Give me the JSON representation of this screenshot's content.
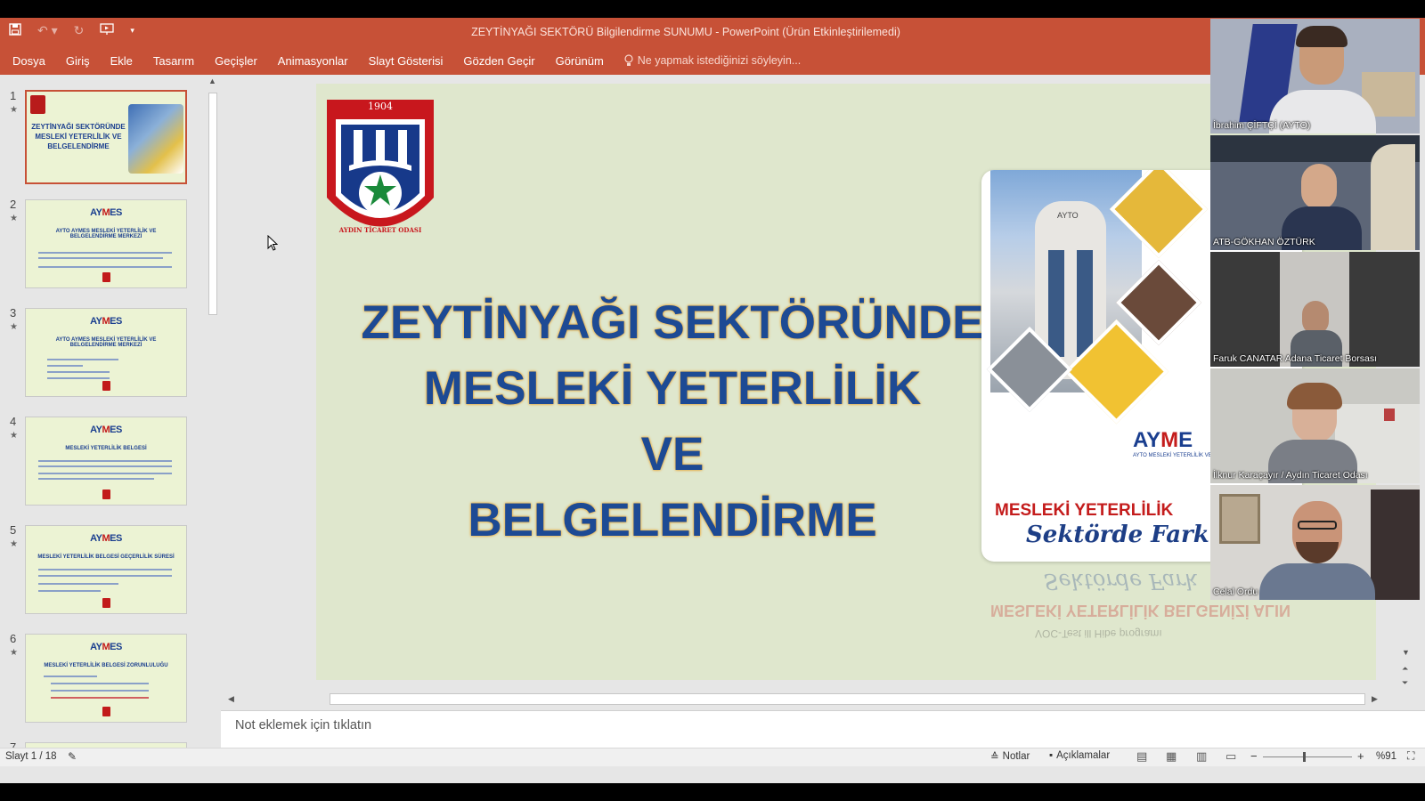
{
  "window": {
    "title": "ZEYTİNYAĞI SEKTÖRÜ Bilgilendirme SUNUMU - PowerPoint (Ürün Etkinleştirilemedi)"
  },
  "ribbon": {
    "tabs": [
      "Dosya",
      "Giriş",
      "Ekle",
      "Tasarım",
      "Geçişler",
      "Animasyonlar",
      "Slayt Gösterisi",
      "Gözden Geçir",
      "Görünüm"
    ],
    "tell_me": "Ne yapmak istediğinizi söyleyin..."
  },
  "thumbnails": [
    {
      "num": "1",
      "title": "ZEYTİNYAĞI SEKTÖRÜNDE MESLEKİ YETERLİLİK VE BELGELENDİRME"
    },
    {
      "num": "2",
      "title": "AYTO AYMES MESLEKİ YETERLİLİK VE BELGELENDİRME MERKEZİ"
    },
    {
      "num": "3",
      "title": "AYTO AYMES MESLEKİ YETERLİLİK VE BELGELENDİRME MERKEZİ"
    },
    {
      "num": "4",
      "title": "MESLEKİ YETERLİLİK BELGESİ"
    },
    {
      "num": "5",
      "title": "MESLEKİ YETERLİLİK BELGESİ GEÇERLİLİK SÜRESİ"
    },
    {
      "num": "6",
      "title": "MESLEKİ YETERLİLİK BELGESİ ZORUNLULUĞU"
    },
    {
      "num": "7",
      "title": ""
    }
  ],
  "thumb_logo": {
    "a": "AY",
    "b": "M",
    "c": "ES"
  },
  "slide": {
    "logo_year": "1904",
    "logo_text": "AYDIN TİCARET ODASI",
    "title_lines": [
      "ZEYTİNYAĞI SEKTÖRÜNDE",
      "MESLEKİ YETERLİLİK",
      "VE",
      "BELGELENDİRME"
    ],
    "brochure": {
      "building_sign": "AYTO",
      "brand_a": "AY",
      "brand_b": "M",
      "brand_c": "E",
      "brand_sub": "AYTO MESLEKİ YETERLİLİK VE BELGELENDİRME MERKEZİ",
      "headline": "MESLEKİ YETERLİLİK",
      "subline": "Sektörde Fark",
      "reflect_1": "MESLEKİ YETERLİLİK BELGENİZİ ALIN",
      "reflect_2": "VOC-Test ill Hibe programı"
    }
  },
  "notes": {
    "placeholder": "Not eklemek için tıklatın"
  },
  "status": {
    "slide_counter": "Slayt 1 / 18",
    "notes_label": "Notlar",
    "comments_label": "Açıklamalar",
    "zoom": "%91"
  },
  "participants": [
    {
      "name": "İbrahim ÇİFTÇİ (AYTO)",
      "bg": "#a9b0bf"
    },
    {
      "name": "ATB-GÖKHAN ÖZTÜRK",
      "bg": "#5d6677"
    },
    {
      "name": "Faruk CANATAR Adana Ticaret Borsası",
      "bg": "#3a3a3a"
    },
    {
      "name": "İlknur Karaçayır / Aydın Ticaret Odası",
      "bg": "#c9c9c4"
    },
    {
      "name": "Celal Ordu",
      "bg": "#d8d6d2"
    }
  ],
  "colors": {
    "accent": "#c75137",
    "slide_bg": "#dfe7cd",
    "title_blue": "#1d4a94",
    "brand_red": "#c41c1c"
  }
}
